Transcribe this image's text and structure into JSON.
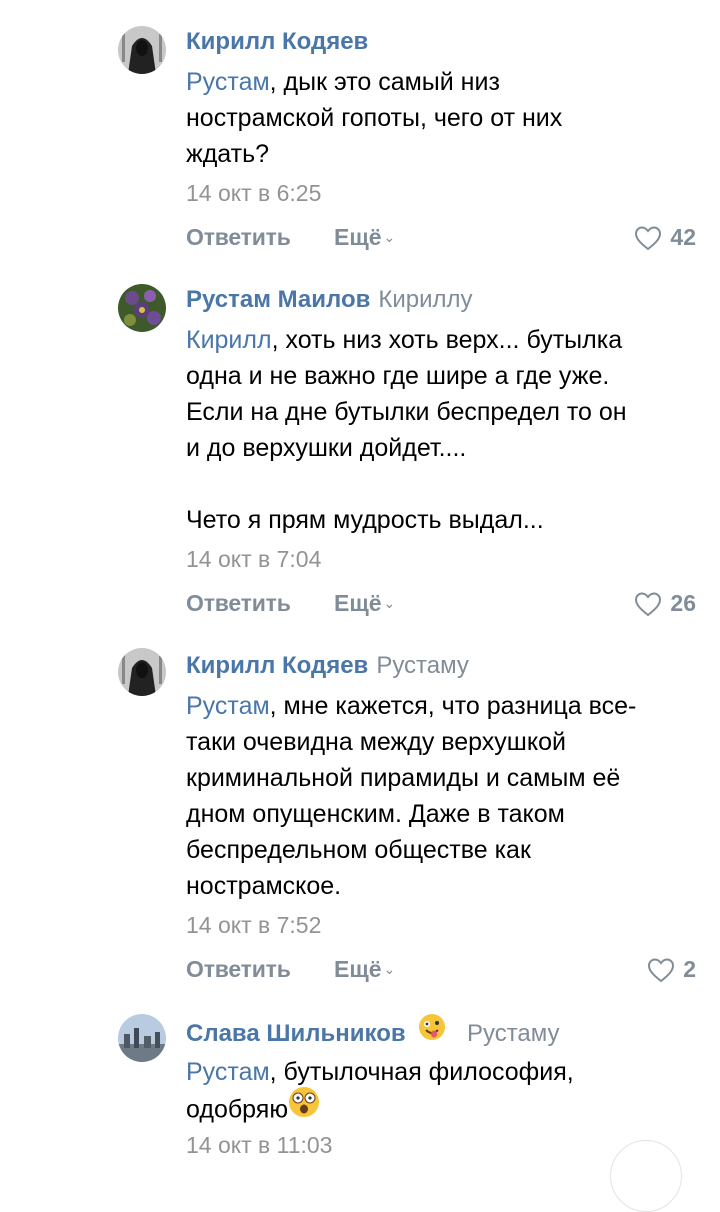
{
  "comments": [
    {
      "author": "Кирилл Кодяев",
      "reply_to": "",
      "mention": "Рустам",
      "text": ", дык это самый низ\nнострамской гопоты, чего от них\nждать?",
      "date": "14 окт в 6:25",
      "reply_label": "Ответить",
      "more_label": "Ещё",
      "likes": "42",
      "avatar_icon": "hooded-figure-avatar"
    },
    {
      "author": "Рустам Маилов",
      "reply_to": "Кириллу",
      "mention": "Кирилл",
      "text": ", хоть низ хоть верх... бутылка\nодна и не важно где шире а где уже.\nЕсли на дне бутылки беспредел то он\nи до верхушки дойдет....\n\nЧето я прям мудрость выдал...",
      "date": "14 окт в 7:04",
      "reply_label": "Ответить",
      "more_label": "Ещё",
      "likes": "26",
      "avatar_icon": "floral-avatar"
    },
    {
      "author": "Кирилл Кодяев",
      "reply_to": "Рустаму",
      "mention": "Рустам",
      "text": ", мне кажется, что разница все-\nтаки очевидна между верхушкой\nкриминальной пирамиды и самым её\nдном опущенским. Даже в таком\nбеспредельном обществе как\nнострамское.",
      "date": "14 окт в 7:52",
      "reply_label": "Ответить",
      "more_label": "Ещё",
      "likes": "2",
      "avatar_icon": "hooded-figure-avatar"
    },
    {
      "author": "Слава Шильников",
      "reply_to": "Рустаму",
      "mention": "Рустам",
      "text": ", бутылочная философия,\nодобряю",
      "date": "14 окт в 11:03",
      "avatar_icon": "city-skyline-avatar"
    }
  ],
  "icons": {
    "like": "heart-outline-icon",
    "more_chevron": "chevron-down-icon",
    "author_badge": "zany-face-emoji",
    "text_emoji": "astonished-face-emoji"
  },
  "colors": {
    "link": "#4a76a8",
    "secondary": "#818c99",
    "date": "#939393",
    "text": "#000000"
  }
}
